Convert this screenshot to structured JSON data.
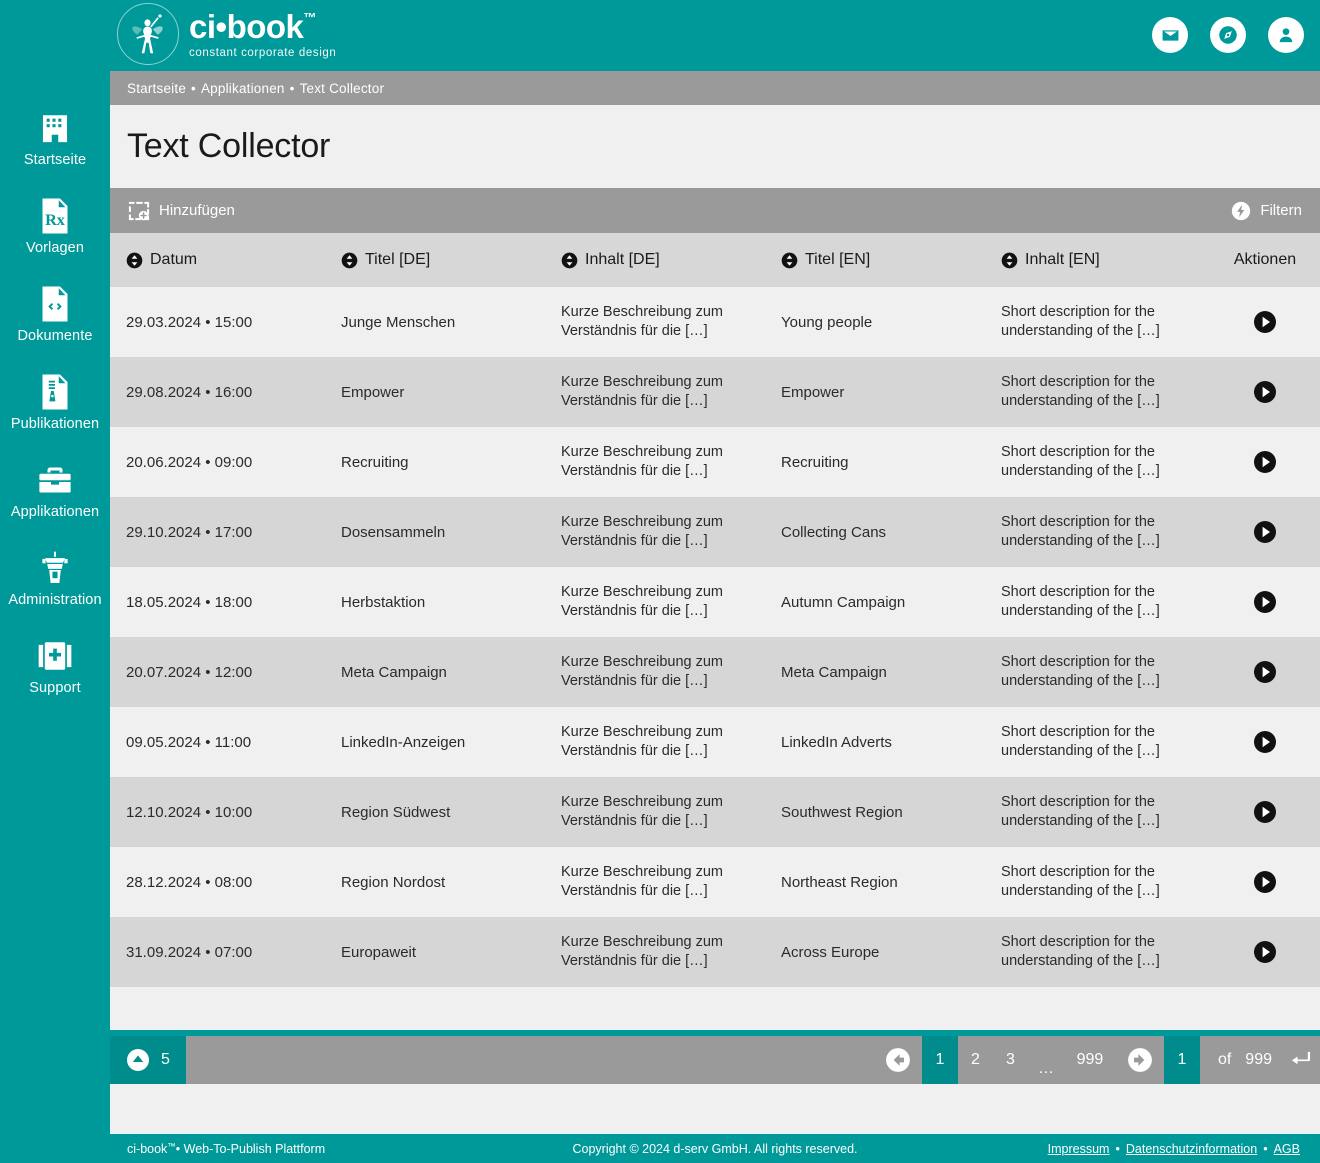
{
  "brand": {
    "logo_main": "ci•book",
    "logo_tm": "™",
    "logo_sub": "constant corporate design",
    "accent_color": "#009999",
    "accent_dark": "#008c8c",
    "toolbar_gray": "#9a9a9a",
    "header_gray": "#d7d7d7",
    "row_light": "#f0f0f0",
    "row_dark": "#d6d6d6"
  },
  "header": {
    "icons": [
      {
        "name": "mail-icon",
        "label": "Nachrichten"
      },
      {
        "name": "compass-icon",
        "label": "Navigator"
      },
      {
        "name": "account-icon",
        "label": "Benutzerkonto"
      }
    ]
  },
  "sidebar": {
    "items": [
      {
        "label": "Startseite",
        "icon": "building-icon"
      },
      {
        "label": "Vorlagen",
        "icon": "template-rx-icon"
      },
      {
        "label": "Dokumente",
        "icon": "document-code-icon"
      },
      {
        "label": "Publikationen",
        "icon": "publication-icon"
      },
      {
        "label": "Applikationen",
        "icon": "toolbox-icon"
      },
      {
        "label": "Administration",
        "icon": "control-tower-icon"
      },
      {
        "label": "Support",
        "icon": "first-aid-icon"
      }
    ]
  },
  "breadcrumb": {
    "items": [
      "Startseite",
      "Applikationen",
      "Text Collector"
    ],
    "separator": "•"
  },
  "page": {
    "title": "Text Collector"
  },
  "toolbar": {
    "add_label": "Hinzufügen",
    "filter_label": "Filtern"
  },
  "table": {
    "columns": [
      {
        "label": "Datum",
        "sortable": true
      },
      {
        "label": "Titel [DE]",
        "sortable": true
      },
      {
        "label": "Inhalt [DE]",
        "sortable": true
      },
      {
        "label": "Titel [EN]",
        "sortable": true
      },
      {
        "label": "Inhalt [EN]",
        "sortable": true
      },
      {
        "label": "Aktionen",
        "sortable": false
      }
    ],
    "content_de": "Kurze Beschreibung zum Verständnis für die […]",
    "content_en": "Short description for the understanding of the […]",
    "rows": [
      {
        "date": "29.03.2024 • 15:00",
        "title_de": "Junge Menschen",
        "content_de": "Kurze Beschreibung zum Verständnis für die […]",
        "title_en": "Young people",
        "content_en": "Short description for the understanding of the […]"
      },
      {
        "date": "29.08.2024 • 16:00",
        "title_de": "Empower",
        "content_de": "Kurze Beschreibung zum Verständnis für die […]",
        "title_en": "Empower",
        "content_en": "Short description for the understanding of the […]"
      },
      {
        "date": "20.06.2024 • 09:00",
        "title_de": "Recruiting",
        "content_de": "Kurze Beschreibung zum Verständnis für die […]",
        "title_en": "Recruiting",
        "content_en": "Short description for the understanding of the […]"
      },
      {
        "date": "29.10.2024 • 17:00",
        "title_de": "Dosensammeln",
        "content_de": "Kurze Beschreibung zum Verständnis für die […]",
        "title_en": "Collecting Cans",
        "content_en": "Short description for the understanding of the […]"
      },
      {
        "date": "18.05.2024 • 18:00",
        "title_de": "Herbstaktion",
        "content_de": "Kurze Beschreibung zum Verständnis für die […]",
        "title_en": "Autumn Campaign",
        "content_en": "Short description for the understanding of the […]"
      },
      {
        "date": "20.07.2024 • 12:00",
        "title_de": "Meta Campaign",
        "content_de": "Kurze Beschreibung zum Verständnis für die […]",
        "title_en": "Meta Campaign",
        "content_en": "Short description for the understanding of the […]"
      },
      {
        "date": "09.05.2024 • 11:00",
        "title_de": "LinkedIn-Anzeigen",
        "content_de": "Kurze Beschreibung zum Verständnis für die […]",
        "title_en": "LinkedIn Adverts",
        "content_en": "Short description for the understanding of the […]"
      },
      {
        "date": "12.10.2024 • 10:00",
        "title_de": "Region Südwest",
        "content_de": "Kurze Beschreibung zum Verständnis für die […]",
        "title_en": "Southwest Region",
        "content_en": "Short description for the understanding of the […]"
      },
      {
        "date": "28.12.2024 • 08:00",
        "title_de": "Region Nordost",
        "content_de": "Kurze Beschreibung zum Verständnis für die […]",
        "title_en": "Northeast Region",
        "content_en": "Short description for the understanding of the […]"
      },
      {
        "date": "31.09.2024 • 07:00",
        "title_de": "Europaweit",
        "content_de": "Kurze Beschreibung zum Verständnis für die […]",
        "title_en": "Across Europe",
        "content_en": "Short description for the understanding of the […]"
      }
    ]
  },
  "pagination": {
    "page_size": "5",
    "pages": [
      "1",
      "2",
      "3"
    ],
    "ellipsis": "…",
    "last_page": "999",
    "current_page": "1",
    "of_label": "of",
    "total_pages": "999"
  },
  "footer": {
    "left_text": "ci-book",
    "left_tm": "™",
    "left_rest": " • Web-To-Publish Plattform",
    "copyright": "Copyright © 2024 d-serv GmbH. All rights reserved.",
    "links": [
      "Impressum",
      "Datenschutzinformation",
      "AGB"
    ],
    "link_sep": "•"
  }
}
